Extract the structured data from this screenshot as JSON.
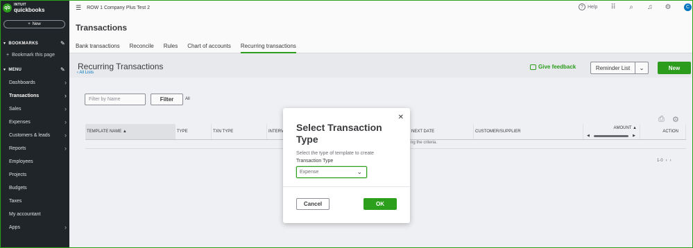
{
  "app": {
    "logo_intuit": "INTUIT",
    "logo_name": "quickbooks",
    "logo_badge": "qb",
    "company_name": "ROW 1 Company Plus Test 2",
    "help_label": "Help",
    "avatar_initial": "C"
  },
  "sidebar": {
    "new_label": "New",
    "bookmarks_header": "BOOKMARKS",
    "bookmark_this_page": "Bookmark this page",
    "menu_header": "MENU",
    "items": [
      {
        "label": "Dashboards",
        "arrow": true
      },
      {
        "label": "Transactions",
        "arrow": true,
        "active": true
      },
      {
        "label": "Sales",
        "arrow": true
      },
      {
        "label": "Expenses",
        "arrow": true
      },
      {
        "label": "Customers & leads",
        "arrow": true
      },
      {
        "label": "Reports",
        "arrow": true
      },
      {
        "label": "Employees",
        "arrow": false
      },
      {
        "label": "Projects",
        "arrow": false
      },
      {
        "label": "Budgets",
        "arrow": false
      },
      {
        "label": "Taxes",
        "arrow": false
      },
      {
        "label": "My accountant",
        "arrow": false
      },
      {
        "label": "Apps",
        "arrow": true
      }
    ]
  },
  "page": {
    "title": "Transactions",
    "tabs": [
      {
        "label": "Bank transactions"
      },
      {
        "label": "Reconcile"
      },
      {
        "label": "Rules"
      },
      {
        "label": "Chart of accounts"
      },
      {
        "label": "Recurring transactions",
        "active": true
      }
    ],
    "section_title": "Recurring Transactions",
    "all_lists_link": "‹ All Lists",
    "give_feedback": "Give feedback",
    "reminder_list": "Reminder List",
    "new_button": "New"
  },
  "filter": {
    "placeholder": "Filter by Name",
    "button": "Filter",
    "all_label": "All"
  },
  "table": {
    "columns": [
      "TEMPLATE NAME ▲",
      "TYPE",
      "TXN TYPE",
      "INTERV",
      "NEXT DATE",
      "CUSTOMER/SUPPLIER",
      "AMOUNT ▲",
      "ACTION"
    ],
    "empty_message": "ng the criteria.",
    "pager": "1-0"
  },
  "modal": {
    "title": "Select Transaction Type",
    "description": "Select the type of template to create",
    "field_label": "Transaction Type",
    "selected_value": "Expense",
    "cancel_label": "Cancel",
    "ok_label": "OK"
  },
  "colors": {
    "brand_green": "#2ca01c",
    "sidebar_bg": "#21262a",
    "link_blue": "#0077c5"
  }
}
